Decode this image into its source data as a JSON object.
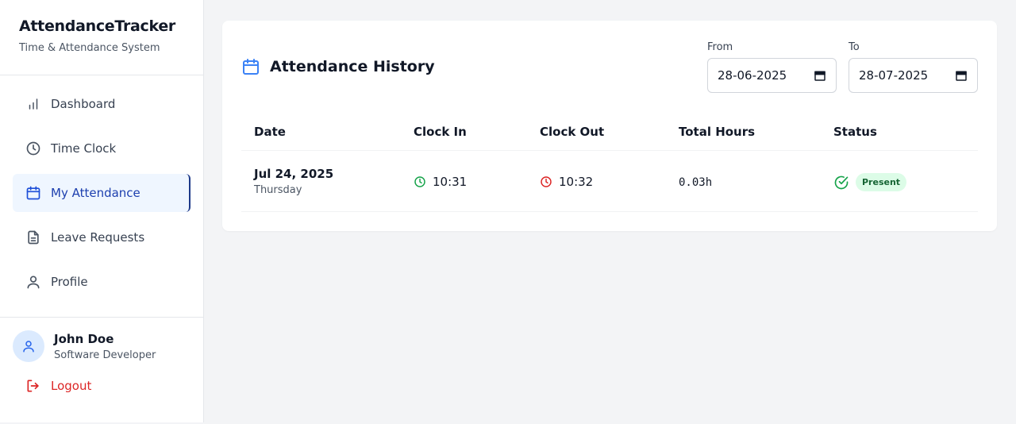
{
  "brand": {
    "title": "AttendanceTracker",
    "subtitle": "Time & Attendance System"
  },
  "nav": {
    "items": [
      {
        "label": "Dashboard",
        "icon": "bar-chart-icon",
        "active": false
      },
      {
        "label": "Time Clock",
        "icon": "clock-icon",
        "active": false
      },
      {
        "label": "My Attendance",
        "icon": "calendar-icon",
        "active": true
      },
      {
        "label": "Leave Requests",
        "icon": "document-icon",
        "active": false
      },
      {
        "label": "Profile",
        "icon": "user-icon",
        "active": false
      }
    ]
  },
  "user": {
    "name": "John Doe",
    "role": "Software Developer",
    "avatar_icon": "user-icon"
  },
  "logout": {
    "label": "Logout",
    "icon": "logout-icon"
  },
  "history": {
    "title": "Attendance History",
    "title_icon": "calendar-icon",
    "from": {
      "label": "From",
      "value": "28-06-2025"
    },
    "to": {
      "label": "To",
      "value": "28-07-2025"
    },
    "columns": [
      "Date",
      "Clock In",
      "Clock Out",
      "Total Hours",
      "Status"
    ],
    "rows": [
      {
        "date": "Jul 24, 2025",
        "weekday": "Thursday",
        "clock_in": "10:31",
        "clock_out": "10:32",
        "total_hours": "0.03h",
        "status": "Present"
      }
    ]
  },
  "colors": {
    "accent": "#1d4ed8",
    "clock_in": "#16a34a",
    "clock_out": "#dc2626",
    "present_bg": "#dcfce7",
    "present_text": "#166534",
    "logout": "#dc2626"
  }
}
